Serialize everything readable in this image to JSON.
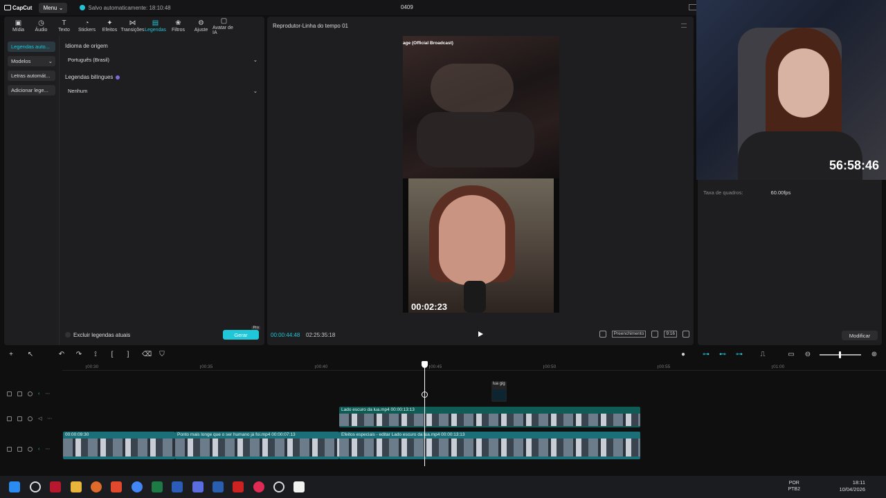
{
  "app": {
    "logo": "CapCut",
    "menu_label": "Menu",
    "autosave": "Salvo automaticamente: 18:10:48",
    "project_title": "0409"
  },
  "toolbar": {
    "items": [
      {
        "label": "Mídia",
        "icon": "media-icon",
        "glyph": "▣"
      },
      {
        "label": "Áudio",
        "icon": "audio-icon",
        "glyph": "◷"
      },
      {
        "label": "Texto",
        "icon": "text-icon",
        "glyph": "T"
      },
      {
        "label": "Stickers",
        "icon": "sticker-icon",
        "glyph": "◔"
      },
      {
        "label": "Efeitos",
        "icon": "effects-icon",
        "glyph": "✦"
      },
      {
        "label": "Transições",
        "icon": "transitions-icon",
        "glyph": "⋈"
      },
      {
        "label": "Legendas",
        "icon": "captions-icon",
        "glyph": "▤",
        "active": true
      },
      {
        "label": "Filtros",
        "icon": "filters-icon",
        "glyph": "❀"
      },
      {
        "label": "Ajuste",
        "icon": "adjust-icon",
        "glyph": "⚙"
      },
      {
        "label": "Avatar de IA",
        "icon": "ai-avatar-icon",
        "glyph": "▢"
      }
    ]
  },
  "captions": {
    "side_buttons": [
      "Legendas auto...",
      "Modelos",
      "Letras automát...",
      "Adicionar lege..."
    ],
    "source_label": "Idioma de origem",
    "source_value": "Português (Brasil)",
    "bilingual_label": "Legendas bilíngues",
    "bilingual_value": "Nenhum",
    "exclude_label": "Excluir legendas atuais",
    "generate_label": "Gerar",
    "pro_badge": "Pro"
  },
  "player": {
    "title": "Reprodutor-Linha do tempo 01",
    "video_label": "age (Official Broadcast)",
    "video_timer": "00:02:23",
    "current_time": "00:00:44:48",
    "total_time": "02:25:35:18",
    "fill_label": "Preenchimento",
    "ratio_label": "9:16"
  },
  "details": {
    "prop_label": "Taxa de quadros:",
    "prop_value": "60.00fps",
    "modify_label": "Modificar"
  },
  "webcam": {
    "timer": "56:58:46"
  },
  "timeline": {
    "ruler": [
      "00:30",
      "00:35",
      "00:40",
      "00:45",
      "00:50",
      "00:55",
      "01:00"
    ],
    "sticker_label": "lua gig",
    "clips": [
      {
        "label": "Lado escuro da lua.mp4  00:00:13:13"
      },
      {
        "label": "00:00:09:30"
      },
      {
        "label": "Ponto mais longe que o ser humano já foi.mp4  00:00:07:13"
      },
      {
        "label": "Efeitos especiais - editar  Lado escuro da lua.mp4  00:00:13:13"
      }
    ]
  },
  "taskbar": {
    "lang": "POR",
    "lang2": "PTB2",
    "time": "18:11",
    "date": "10/04/2026"
  }
}
